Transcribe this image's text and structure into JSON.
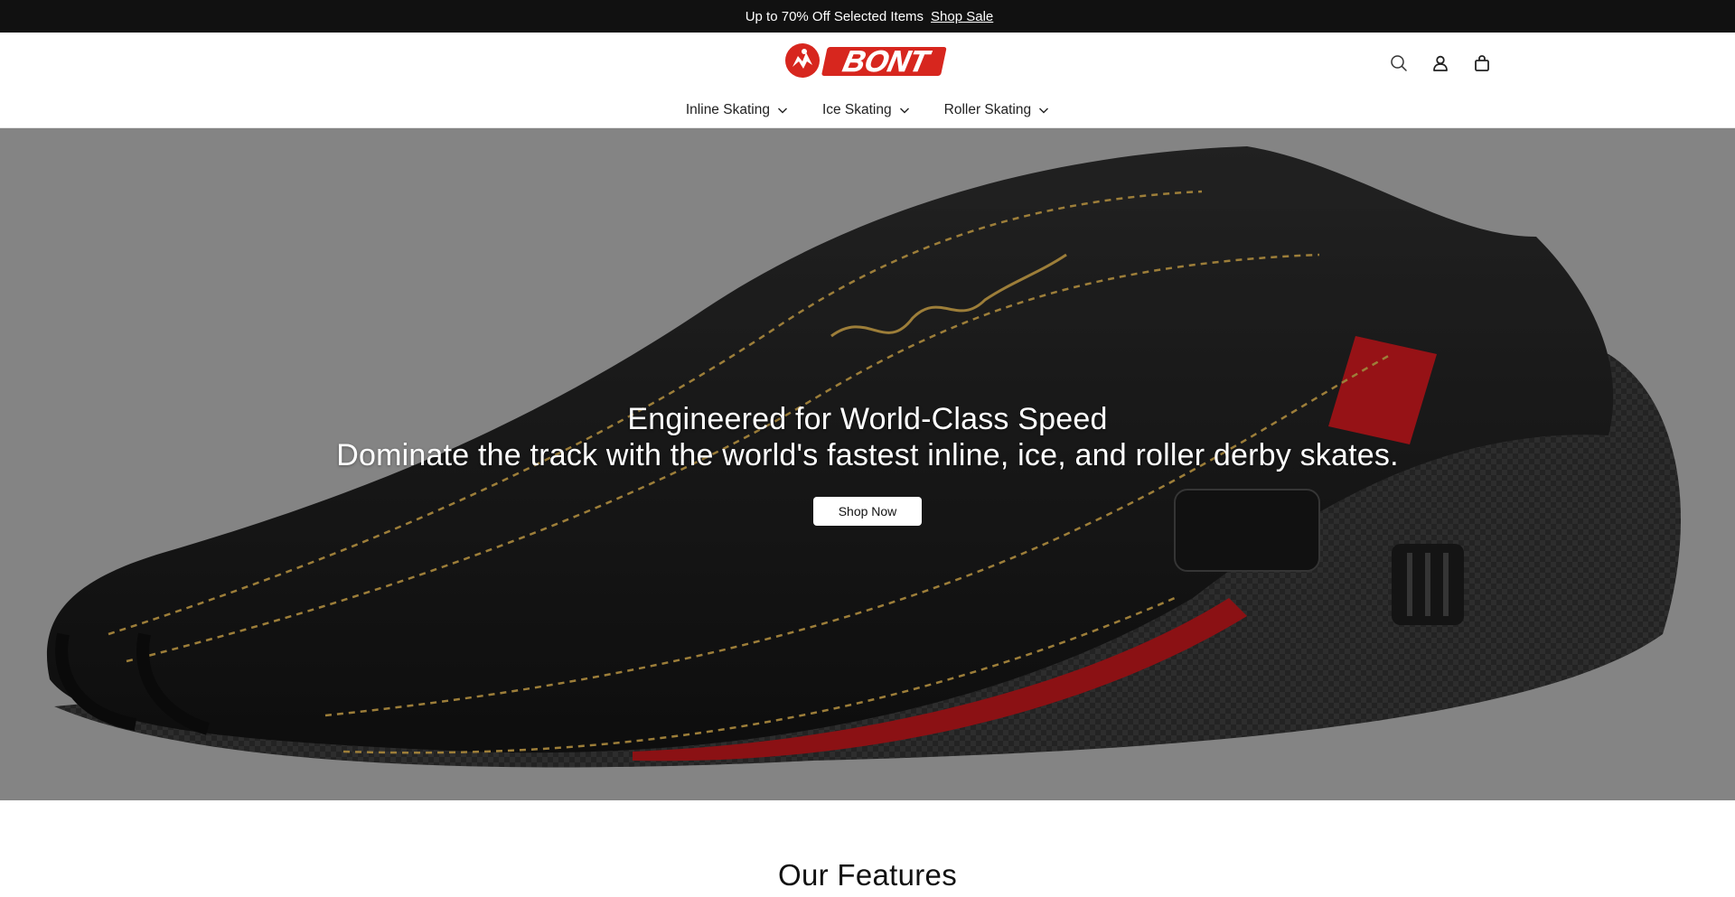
{
  "announcement": {
    "glyph": "",
    "message": "Up to 70% Off Selected Items",
    "link_label": "Shop Sale",
    "close_glyph": ""
  },
  "brand": {
    "logo_text": "BONT",
    "accent_color": "#d7261e"
  },
  "header": {
    "icons": [
      "search-icon",
      "account-icon",
      "cart-icon"
    ]
  },
  "nav": {
    "items": [
      {
        "label": "Inline Skating"
      },
      {
        "label": "Ice Skating"
      },
      {
        "label": "Roller Skating"
      }
    ]
  },
  "hero": {
    "title": "Engineered for World-Class Speed",
    "subtitle": "Dominate the track with the world's fastest inline, ice, and roller derby skates.",
    "cta_label": "Shop Now",
    "background_color": "#a9a9a9"
  },
  "features": {
    "title": "Our Features"
  }
}
